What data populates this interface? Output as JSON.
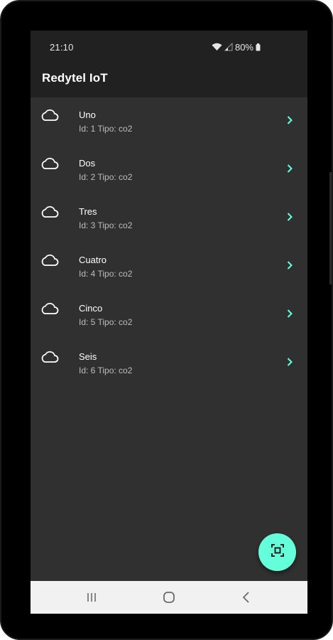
{
  "status_bar": {
    "time": "21:10",
    "battery": "80%",
    "icons": [
      "wifi-icon",
      "signal-icon",
      "battery-icon"
    ]
  },
  "app_bar": {
    "title": "Redytel IoT"
  },
  "devices": [
    {
      "name": "Uno",
      "subtitle": "Id: 1 Tipo: co2",
      "icon": "cloud-icon"
    },
    {
      "name": "Dos",
      "subtitle": "Id: 2 Tipo: co2",
      "icon": "cloud-icon"
    },
    {
      "name": "Tres",
      "subtitle": "Id: 3 Tipo: co2",
      "icon": "cloud-icon"
    },
    {
      "name": "Cuatro",
      "subtitle": "Id: 4 Tipo: co2",
      "icon": "cloud-icon"
    },
    {
      "name": "Cinco",
      "subtitle": "Id: 5 Tipo: co2",
      "icon": "cloud-icon"
    },
    {
      "name": "Seis",
      "subtitle": "Id: 6 Tipo: co2",
      "icon": "cloud-icon"
    }
  ],
  "fab": {
    "icon": "qr-scan-icon"
  },
  "nav_bar": {
    "buttons": [
      "recent-apps-icon",
      "home-icon",
      "back-icon"
    ]
  },
  "colors": {
    "accent": "#64ffda",
    "app_bar": "#212121",
    "background": "#303030",
    "nav_bar": "#f1f1f1"
  }
}
